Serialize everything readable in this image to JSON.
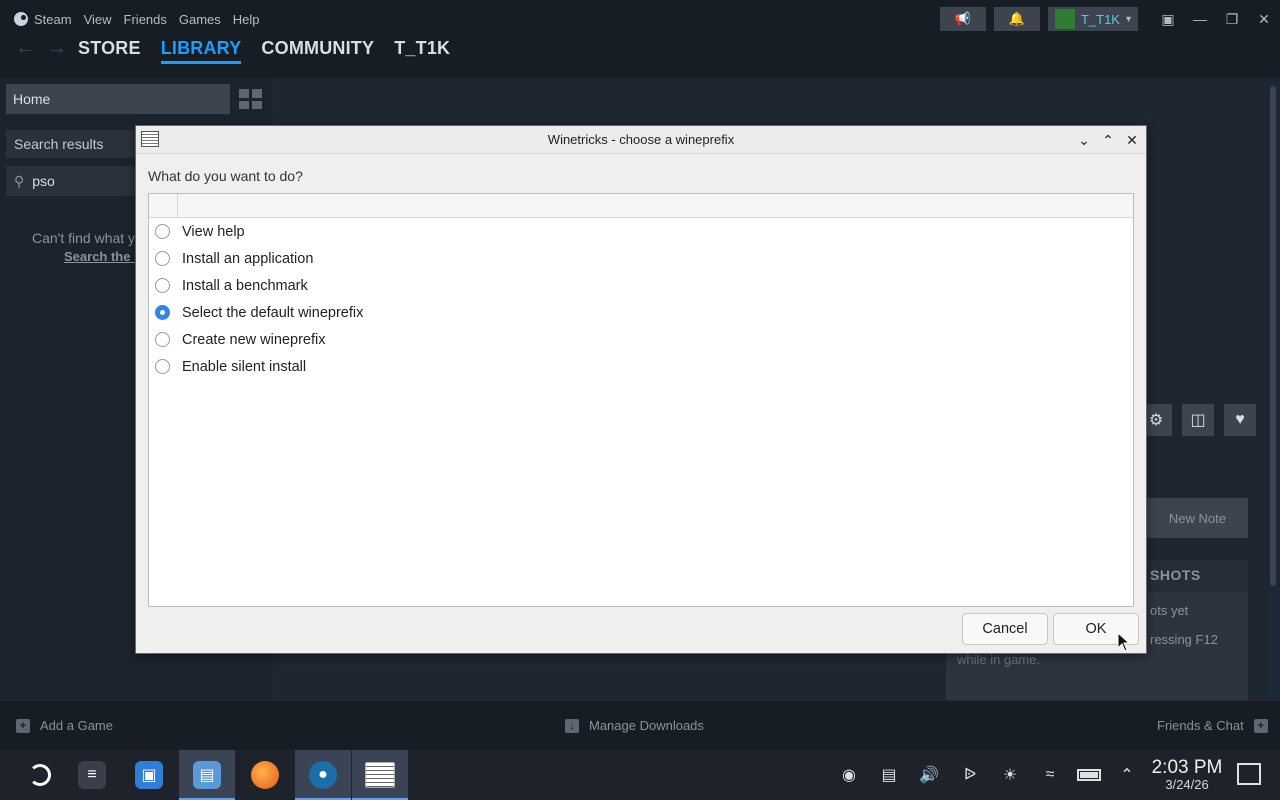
{
  "steam": {
    "menu": [
      "Steam",
      "View",
      "Friends",
      "Games",
      "Help"
    ],
    "nav": [
      "STORE",
      "LIBRARY",
      "COMMUNITY",
      "T_T1K"
    ],
    "user": "T_T1K",
    "left": {
      "home": "Home",
      "results": "Search results",
      "search_value": "pso",
      "cant_find": "Can't find what y",
      "search_store": "Search the s"
    },
    "main": {
      "new_note": "New Note",
      "shots_title": "SHOTS",
      "shots_line1": "ots yet",
      "shots_line2": "ressing F12",
      "shots_line3": "while in game."
    },
    "bottom": {
      "add_game": "Add a Game",
      "downloads": "Manage Downloads",
      "friends": "Friends & Chat"
    }
  },
  "dialog": {
    "title": "Winetricks - choose a wineprefix",
    "question": "What do you want to do?",
    "options": [
      {
        "label": "View help",
        "selected": false
      },
      {
        "label": "Install an application",
        "selected": false
      },
      {
        "label": "Install a benchmark",
        "selected": false
      },
      {
        "label": "Select the default wineprefix",
        "selected": true
      },
      {
        "label": "Create new wineprefix",
        "selected": false
      },
      {
        "label": "Enable silent install",
        "selected": false
      }
    ],
    "cancel": "Cancel",
    "ok": "OK"
  },
  "taskbar": {
    "time": "2:03 PM",
    "date": "3/24/26"
  },
  "colors": {
    "steam_accent": "#1a9fff",
    "radio_selected": "#3584e4"
  },
  "icons": [
    "steam-icon",
    "megaphone-icon",
    "bell-icon",
    "monitor-icon",
    "minimize-icon",
    "maximize-icon",
    "close-icon",
    "gear-icon",
    "controller-icon",
    "heart-icon",
    "wifi-icon",
    "bluetooth-icon",
    "volume-icon",
    "battery-icon"
  ]
}
